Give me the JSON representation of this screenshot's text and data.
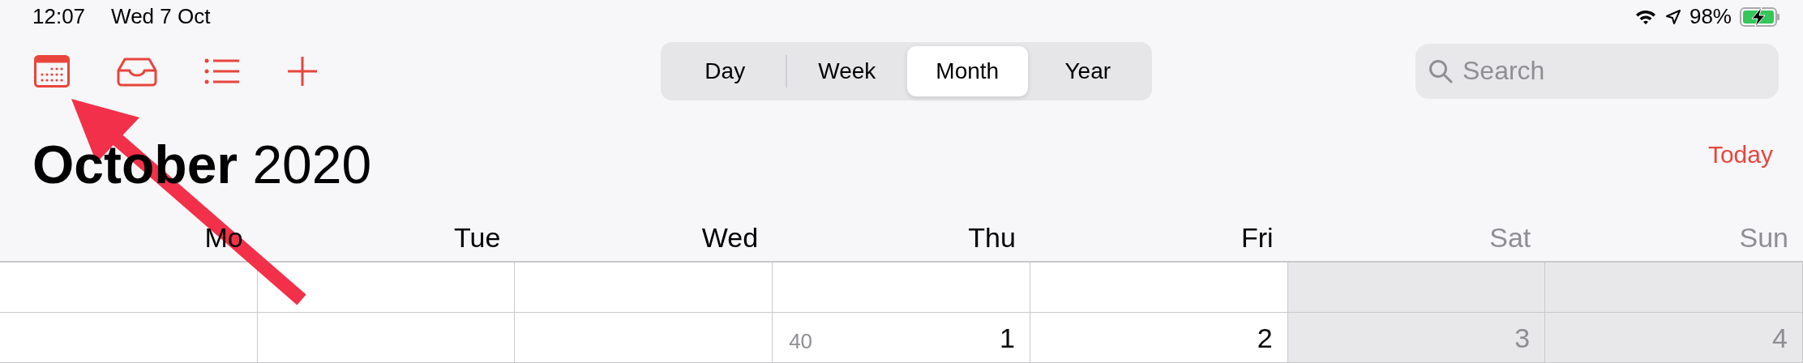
{
  "status_bar": {
    "time": "12:07",
    "date": "Wed 7 Oct",
    "battery": "98%"
  },
  "segments": [
    {
      "label": "Day",
      "selected": false
    },
    {
      "label": "Week",
      "selected": false
    },
    {
      "label": "Month",
      "selected": true
    },
    {
      "label": "Year",
      "selected": false
    }
  ],
  "search": {
    "placeholder": "Search"
  },
  "title": {
    "month": "October",
    "year": "2020"
  },
  "today_button": "Today",
  "weekdays": [
    {
      "label": "Mo",
      "weekend": false
    },
    {
      "label": "Tue",
      "weekend": false
    },
    {
      "label": "Wed",
      "weekend": false
    },
    {
      "label": "Thu",
      "weekend": false
    },
    {
      "label": "Fri",
      "weekend": false
    },
    {
      "label": "Sat",
      "weekend": true
    },
    {
      "label": "Sun",
      "weekend": true
    }
  ],
  "rows": [
    {
      "cells": [
        {},
        {},
        {},
        {},
        {},
        {},
        {}
      ]
    },
    {
      "cells": [
        {},
        {},
        {},
        {
          "week": "40",
          "day": "1"
        },
        {
          "day": "2"
        },
        {
          "day": "3"
        },
        {
          "day": "4"
        }
      ]
    }
  ]
}
